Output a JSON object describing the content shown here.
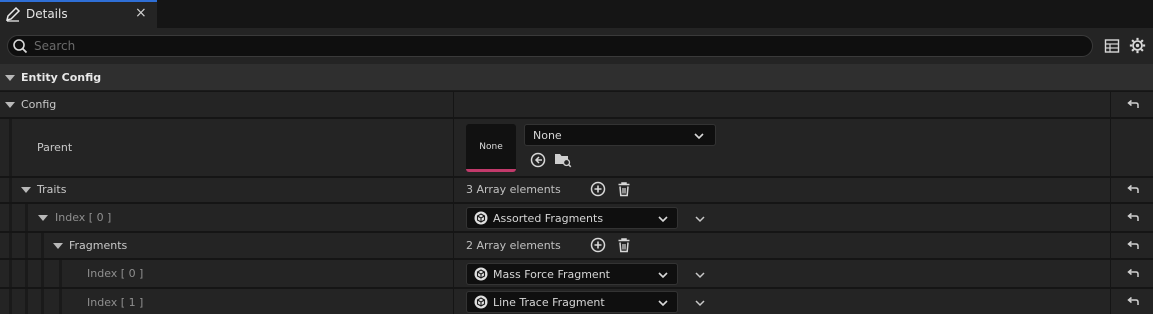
{
  "tab": {
    "title": "Details",
    "close": "×"
  },
  "search": {
    "placeholder": "Search",
    "value": ""
  },
  "category": {
    "label": "Entity Config"
  },
  "config": {
    "label": "Config"
  },
  "parent": {
    "label": "Parent",
    "thumbnail": "None",
    "selected": "None"
  },
  "traits": {
    "label": "Traits",
    "count_text": "3 Array elements"
  },
  "index0": {
    "label": "Index [ 0 ]",
    "value": "Assorted Fragments"
  },
  "fragments": {
    "label": "Fragments",
    "count_text": "2 Array elements"
  },
  "frag0": {
    "label": "Index [ 0 ]",
    "value": "Mass Force Fragment"
  },
  "frag1": {
    "label": "Index [ 1 ]",
    "value": "Line Trace Fragment"
  },
  "colors": {
    "accent_tab": "#2f6fd6",
    "thumb_underline": "#c23a6b"
  }
}
